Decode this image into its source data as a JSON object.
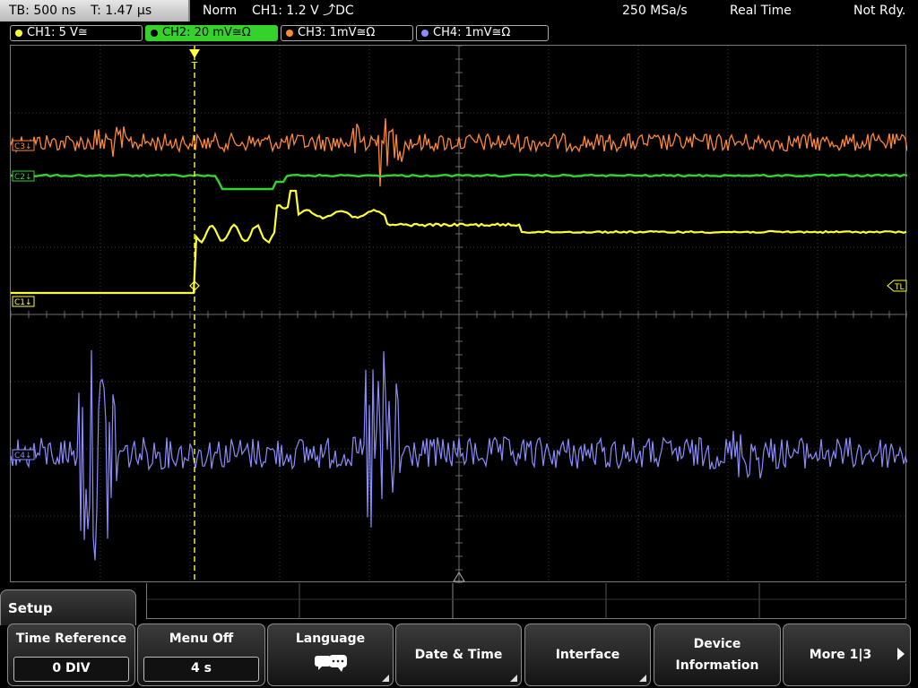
{
  "topbar": {
    "timebase": "TB: 500 ns",
    "trigger_time": "T: 1.47 µs",
    "mode": "Norm",
    "trigger_info": "CH1: 1.2 V ⤴DC",
    "sample_rate": "250 MSa/s",
    "acq_mode": "Real Time",
    "status": "Not Rdy."
  },
  "channels": [
    {
      "label": "CH1: 5 V≅",
      "color": "#ffff33",
      "active": false
    },
    {
      "label": "CH2: 20 mV≅Ω",
      "color": "#36d22c",
      "active": true
    },
    {
      "label": "CH3: 1mV≅Ω",
      "color": "#ff8833",
      "active": false
    },
    {
      "label": "CH4: 1mV≅Ω",
      "color": "#8c8cff",
      "active": false
    }
  ],
  "markers": {
    "c3": "C3↓",
    "c2": "C2↓",
    "c1": "C1↓",
    "c4": "C4↓",
    "trigger_level": "TL",
    "trigger_pos": "T"
  },
  "menu": {
    "title": "Setup",
    "softkeys": [
      {
        "label": "Time Reference",
        "value": "0 DIV"
      },
      {
        "label": "Menu Off",
        "value": "4 s"
      },
      {
        "label": "Language",
        "icon": "speech-bubbles-icon"
      },
      {
        "label": "Date & Time"
      },
      {
        "label": "Interface"
      },
      {
        "label": "Device",
        "label2": "Information"
      },
      {
        "label": "More 1|3"
      }
    ]
  }
}
